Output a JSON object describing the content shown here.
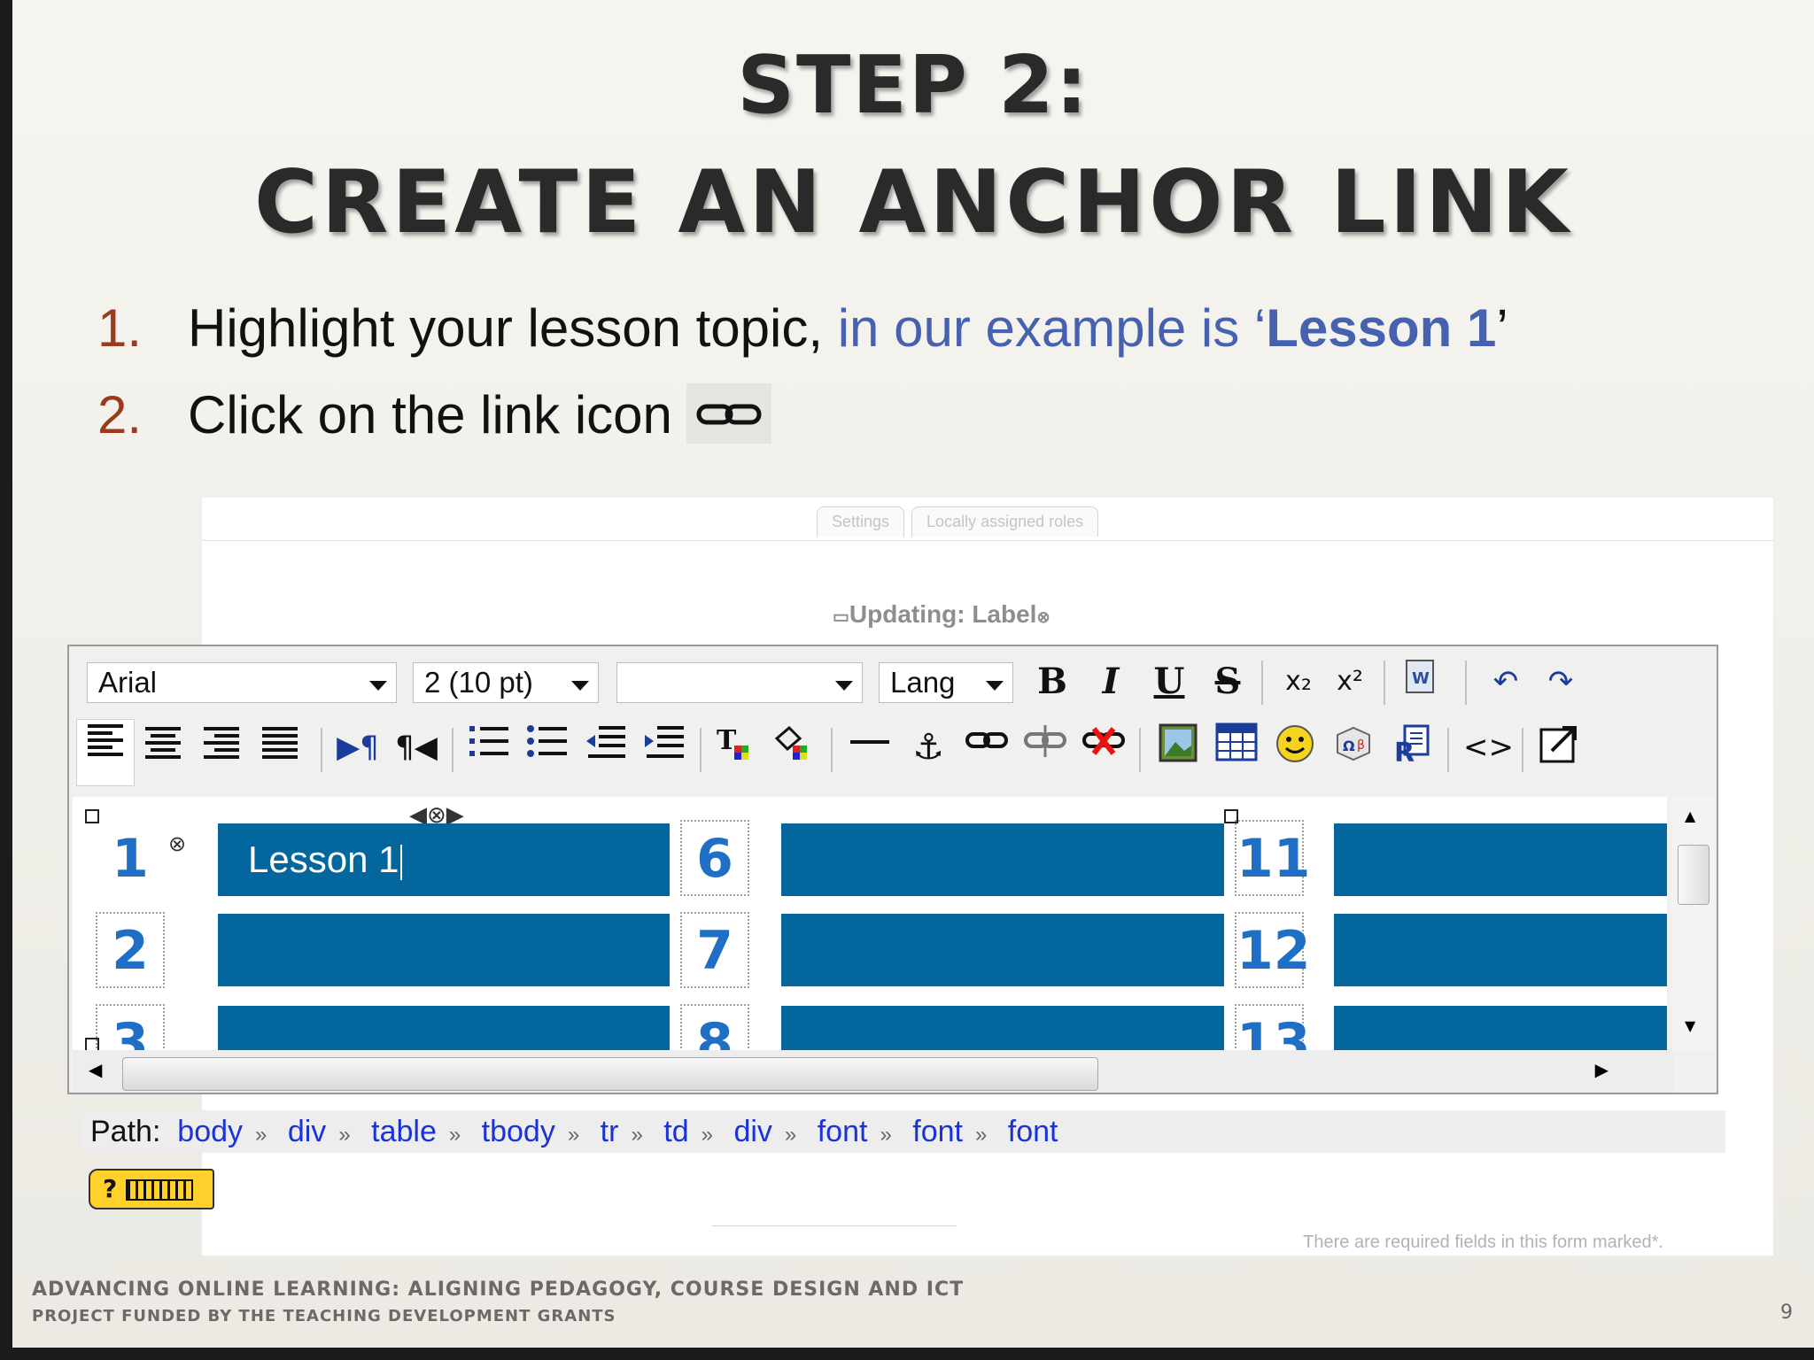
{
  "slide": {
    "title_line1": "Step 2:",
    "title_line2": "Create an anchor link",
    "steps": [
      {
        "num": "1.",
        "text_a": "Highlight your lesson topic, ",
        "text_b": "in our example is ‘",
        "text_c": "Lesson 1",
        "text_d": "’"
      },
      {
        "num": "2.",
        "text": "Click on the link icon"
      }
    ],
    "footer_line1": "Advancing Online Learning: Aligning Pedagogy, Course Design and ICT",
    "footer_line2": "Project funded by the Teaching Development Grants",
    "slide_number": "9"
  },
  "screenshot": {
    "tabs": [
      "Settings",
      "Locally assigned roles"
    ],
    "heading": "Updating: Label",
    "required_note": "There are required fields in this form marked*.",
    "toolbar": {
      "font_family": "Arial",
      "font_size": "2 (10 pt)",
      "style": "",
      "lang": "Lang"
    },
    "table": {
      "numbers": [
        "1",
        "2",
        "3",
        "6",
        "7",
        "8",
        "11",
        "12",
        "13"
      ],
      "selected_text": "Lesson 1"
    },
    "path_label": "Path:",
    "path": [
      "body",
      "div",
      "table",
      "tbody",
      "tr",
      "td",
      "div",
      "font",
      "font",
      "font"
    ],
    "help_badge": "?"
  },
  "colors": {
    "bar_blue": "#03679e",
    "number_blue": "#1f6fc6",
    "step_number": "#9b3b1c",
    "highlight_blue": "#4561b0"
  }
}
